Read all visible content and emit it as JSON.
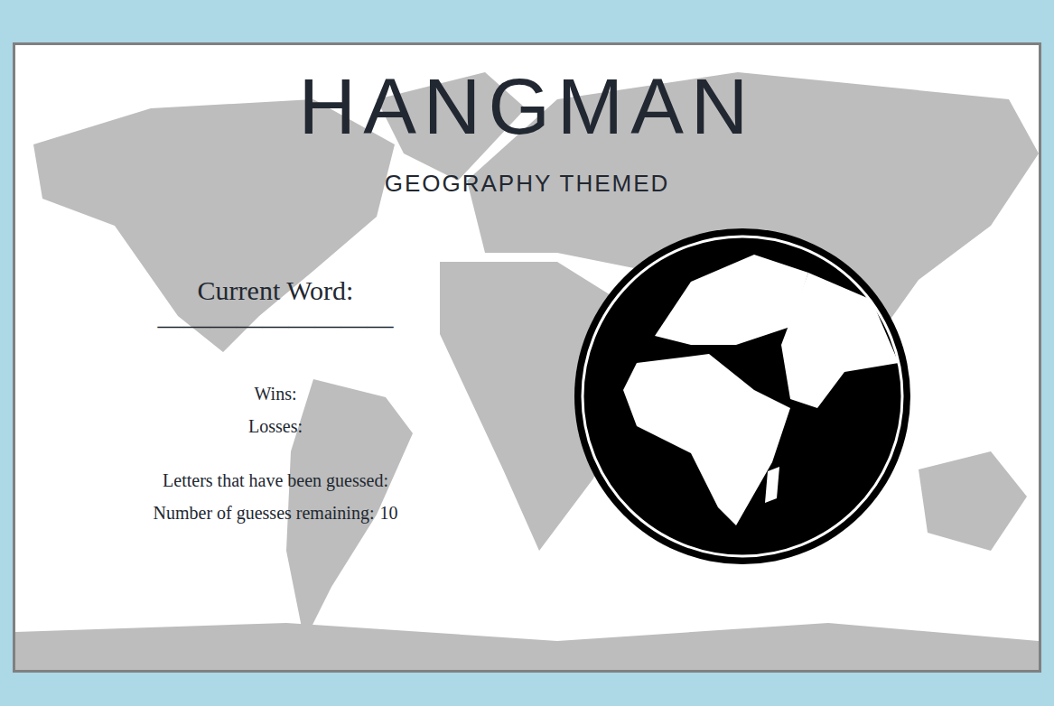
{
  "title": "HANGMAN",
  "subtitle": "GEOGRAPHY THEMED",
  "current_word": {
    "label": "Current Word:",
    "blanks": "—————————"
  },
  "stats": {
    "wins": "Wins:",
    "losses": "Losses:"
  },
  "guessed": {
    "label": "Letters that have been guessed:"
  },
  "remaining": {
    "label": "Number of guesses remaining:",
    "value": "10"
  }
}
